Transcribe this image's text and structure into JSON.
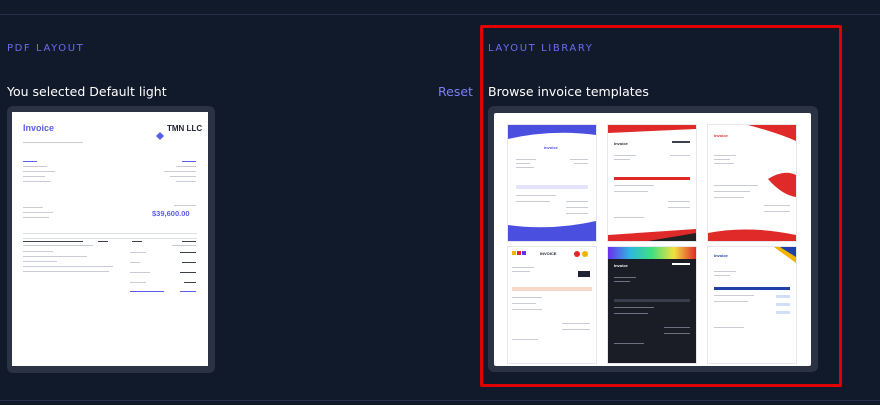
{
  "pdf_layout": {
    "section_title": "PDF LAYOUT",
    "selected_text": "You selected Default light",
    "reset_label": "Reset",
    "preview": {
      "title": "Invoice",
      "logo_icon": "diamond-logo-icon",
      "logo_text": "TMN LLC",
      "total": "$39,600.00"
    }
  },
  "layout_library": {
    "section_title": "LAYOUT LIBRARY",
    "browse_text": "Browse invoice templates",
    "templates": [
      {
        "name": "blue-wave-template",
        "title": "Invoice"
      },
      {
        "name": "red-slant-template",
        "title": "Invoice"
      },
      {
        "name": "red-curve-template",
        "title": "Invoice"
      },
      {
        "name": "multi-color-template",
        "title": "INVOICE"
      },
      {
        "name": "dark-gradient-template",
        "title": "Invoice"
      },
      {
        "name": "blue-yellow-template",
        "title": "Invoice"
      }
    ]
  },
  "colors": {
    "background": "#111a2b",
    "accent": "#6b6df0",
    "highlight": "#e10000",
    "frame": "#2a3244"
  }
}
